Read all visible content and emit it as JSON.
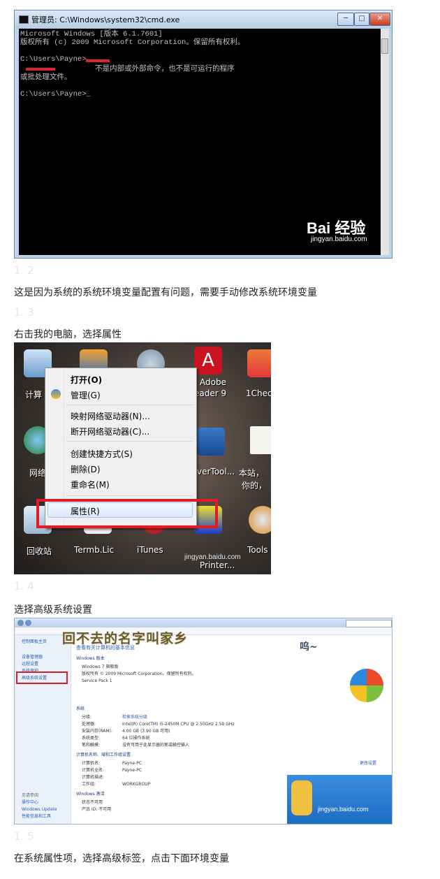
{
  "cmd": {
    "title": "管理员: C:\\Windows\\system32\\cmd.exe",
    "lines": [
      "Microsoft Windows [版本 6.1.7601]",
      "版权所有 (c) 2009 Microsoft Corporation。保留所有权利。",
      "",
      "C:\\Users\\Payne>",
      "                 不是内部或外部命令，也不是可运行的程序",
      "或批处理文件。",
      "",
      "C:\\Users\\Payne>_"
    ],
    "watermark_brand": "Bai  经验",
    "watermark_site": "jingyan.baidu.com",
    "buttons": {
      "minimize": "─",
      "maximize": "□",
      "close": "✕"
    }
  },
  "steps": {
    "s12": {
      "num": "1. 2",
      "text": "这是因为系统的系统环境变量配置有问题，需要手动修改系统环境变量"
    },
    "s13": {
      "num": "1. 3",
      "text": "右击我的电脑，选择属性"
    },
    "s14": {
      "num": "1. 4",
      "text": "选择高级系统设置"
    },
    "s15": {
      "num": "1. 5",
      "text": "在系统属性项，选择高级标签，点击下面环境变量"
    }
  },
  "desktop": {
    "icons": [
      {
        "label": "计算"
      },
      {
        "label": "Adobe"
      },
      {
        "label": "eader 9"
      },
      {
        "label": "1Chec"
      },
      {
        "label": "网络"
      },
      {
        "label": "verTool..."
      },
      {
        "label": "本站，"
      },
      {
        "label": "你的，"
      },
      {
        "label": "回收站"
      },
      {
        "label": "Termb.Lic"
      },
      {
        "label": "iTunes"
      },
      {
        "label": "Printer..."
      },
      {
        "label": "Tools"
      }
    ],
    "context_menu": [
      {
        "label": "打开(O)",
        "bold": true
      },
      {
        "label": "管理(G)"
      },
      {
        "label": "映射网络驱动器(N)..."
      },
      {
        "label": "断开网络驱动器(C)..."
      },
      {
        "label": "创建快捷方式(S)"
      },
      {
        "label": "删除(D)"
      },
      {
        "label": "重命名(M)"
      },
      {
        "label": "属性(R)"
      }
    ],
    "watermark_site": "jingyan.baidu.com"
  },
  "system": {
    "overlay_title": "回不去的名字叫家乡",
    "overlay_sub": "呜~",
    "page_heading": "查看有关计算机的基本信息",
    "sidebar": [
      "控制面板主页",
      "设备管理器",
      "远程设置",
      "系统保护",
      "高级系统设置"
    ],
    "sidebar_bottom": [
      "另请参阅",
      "操作中心",
      "Windows Update",
      "性能信息和工具"
    ],
    "section_edition": "Windows 版本",
    "edition_lines": [
      "Windows 7 旗舰版",
      "版权所有 © 2009 Microsoft Corporation。保留所有权利。",
      "Service Pack 1"
    ],
    "section_system": "系统",
    "system_rows": [
      [
        "分级:",
        "检索系统分级"
      ],
      [
        "处理器:",
        "Intel(R) Core(TM) i5-2450M CPU @ 2.50GHz   2.50 GHz"
      ],
      [
        "安装内存(RAM):",
        "4.00 GB (3.90 GB 可用)"
      ],
      [
        "系统类型:",
        "64 位操作系统"
      ],
      [
        "笔和触摸:",
        "没有可用于此显示器的笔或触控输入"
      ]
    ],
    "section_computer": "计算机名称、域和工作组设置",
    "computer_rows": [
      [
        "计算机名:",
        "Payne-PC"
      ],
      [
        "计算机全名:",
        "Payne-PC"
      ],
      [
        "计算机描述:",
        ""
      ],
      [
        "工作组:",
        "WORKGROUP"
      ]
    ],
    "change_settings": "更改设置",
    "section_activation": "Windows 激活",
    "activation_rows": [
      [
        "状态不可用",
        ""
      ],
      [
        "产品 ID: 不可用",
        ""
      ]
    ],
    "watermark_site": "jingyan.baidu.com"
  },
  "colors": {
    "accent_red": "#e01c24",
    "cmd_bg": "#000000",
    "step_num": "#e6e6e6"
  }
}
